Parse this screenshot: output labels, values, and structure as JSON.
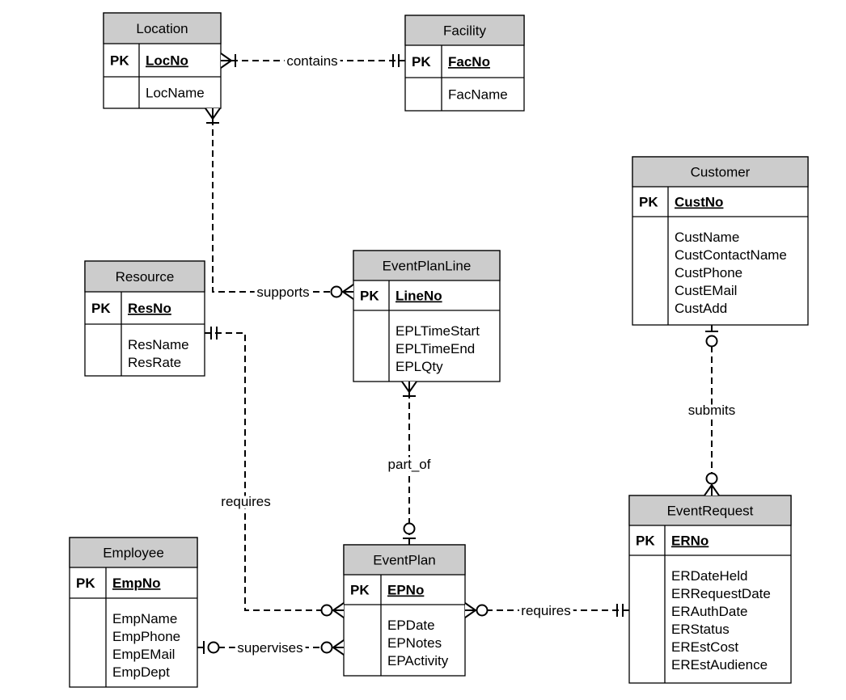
{
  "entities": [
    {
      "name": "Location",
      "pk_label": "PK",
      "key": "LocNo",
      "attributes": [
        "LocName"
      ]
    },
    {
      "name": "Facility",
      "pk_label": "PK",
      "key": "FacNo",
      "attributes": [
        "FacName"
      ]
    },
    {
      "name": "Customer",
      "pk_label": "PK",
      "key": "CustNo",
      "attributes": [
        "CustName",
        "CustContactName",
        "CustPhone",
        "CustEMail",
        "CustAdd"
      ]
    },
    {
      "name": "Resource",
      "pk_label": "PK",
      "key": "ResNo",
      "attributes": [
        "ResName",
        "ResRate"
      ]
    },
    {
      "name": "EventPlanLine",
      "pk_label": "PK",
      "key": "LineNo",
      "attributes": [
        "EPLTimeStart",
        "EPLTimeEnd",
        "EPLQty"
      ]
    },
    {
      "name": "EventRequest",
      "pk_label": "PK",
      "key": "ERNo",
      "attributes": [
        "ERDateHeld",
        "ERRequestDate",
        "ERAuthDate",
        "ERStatus",
        "EREstCost",
        "EREstAudience"
      ]
    },
    {
      "name": "Employee",
      "pk_label": "PK",
      "key": "EmpNo",
      "attributes": [
        "EmpName",
        "EmpPhone",
        "EmpEMail",
        "EmpDept"
      ]
    },
    {
      "name": "EventPlan",
      "pk_label": "PK",
      "key": "EPNo",
      "attributes": [
        "EPDate",
        "EPNotes",
        "EPActivity"
      ]
    }
  ],
  "relationships": [
    {
      "label": "contains",
      "from": "Location",
      "from_cardinality": "one-or-many",
      "to": "Facility",
      "to_cardinality": "exactly-one"
    },
    {
      "label": "supports",
      "from": "Location",
      "from_cardinality": "one-or-many",
      "to": "EventPlanLine",
      "to_cardinality": "zero-or-many"
    },
    {
      "label": "requires",
      "from": "Resource",
      "from_cardinality": "exactly-one",
      "to": "EventPlan",
      "to_cardinality": "zero-or-many"
    },
    {
      "label": "part_of",
      "from": "EventPlanLine",
      "from_cardinality": "one-or-many",
      "to": "EventPlan",
      "to_cardinality": "zero-or-one"
    },
    {
      "label": "submits",
      "from": "Customer",
      "from_cardinality": "zero-or-one",
      "to": "EventRequest",
      "to_cardinality": "zero-or-many"
    },
    {
      "label": "requires",
      "from": "EventPlan",
      "from_cardinality": "zero-or-many",
      "to": "EventRequest",
      "to_cardinality": "exactly-one"
    },
    {
      "label": "supervises",
      "from": "Employee",
      "from_cardinality": "zero-or-one",
      "to": "EventPlan",
      "to_cardinality": "zero-or-many"
    }
  ]
}
